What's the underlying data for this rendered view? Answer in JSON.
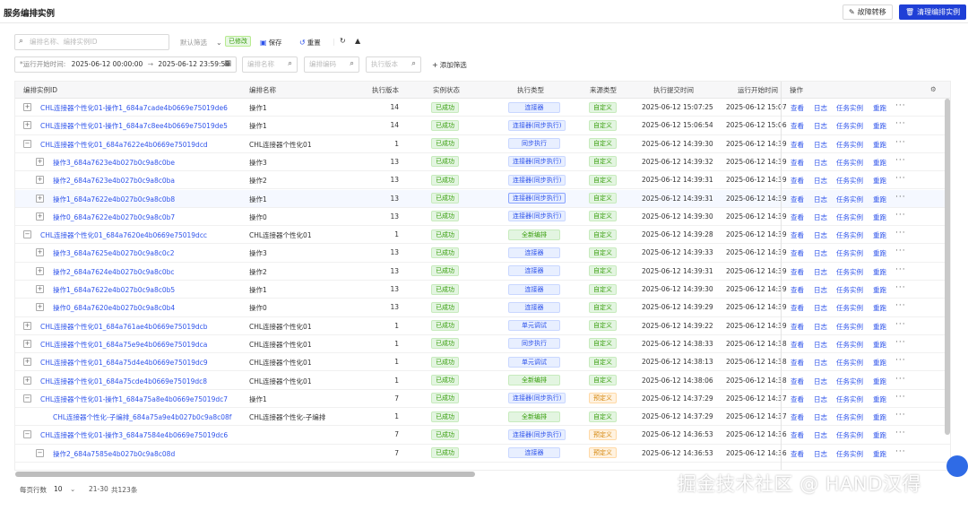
{
  "header": {
    "title": "服务编排实例",
    "failover_label": "故障转移",
    "clean_label": "清理编排实例"
  },
  "toolbar": {
    "search_placeholder": "编排名称、编排实例ID",
    "filter_label": "默认筛选",
    "modified_badge": "已修改",
    "save_label": "保存",
    "reset_label": "重置"
  },
  "filters": {
    "time_label": "*运行开始时间:",
    "time_start": "2025-06-12 00:00:00",
    "time_sep": "→",
    "time_end": "2025-06-12 23:59:59",
    "name_placeholder": "编排名称",
    "code_placeholder": "编排编码",
    "version_placeholder": "执行版本",
    "add_filter_label": "添加筛选"
  },
  "table": {
    "columns": [
      "编排实例ID",
      "编排名称",
      "执行版本",
      "实例状态",
      "执行类型",
      "来源类型",
      "执行提交时间",
      "运行开始时间",
      "操作"
    ],
    "actions": [
      "查看",
      "日志",
      "任务实例",
      "重跑"
    ],
    "rows": [
      {
        "indent": 0,
        "exp": "+",
        "id": "CHL连接器个性化01-操作1_684a7cade4b0669e75019de6",
        "name": "操作1",
        "ver": "14",
        "status": "已成功",
        "type": "连接器",
        "tstyle": "exec",
        "src": "自定义",
        "sstyle": "src",
        "submit": "2025-06-12 15:07:25",
        "start": "2025-06-12 15:07"
      },
      {
        "indent": 0,
        "exp": "+",
        "id": "CHL连接器个性化01-操作1_684a7c8ee4b0669e75019de5",
        "name": "操作1",
        "ver": "14",
        "status": "已成功",
        "type": "连接器(同步执行)",
        "tstyle": "exec",
        "src": "自定义",
        "sstyle": "src",
        "submit": "2025-06-12 15:06:54",
        "start": "2025-06-12 15:06"
      },
      {
        "indent": 0,
        "exp": "−",
        "id": "CHL连接器个性化01_684a7622e4b0669e75019dcd",
        "name": "CHL连接器个性化01",
        "ver": "1",
        "status": "已成功",
        "type": "同步执行",
        "tstyle": "exec",
        "src": "自定义",
        "sstyle": "src",
        "submit": "2025-06-12 14:39:30",
        "start": "2025-06-12 14:39"
      },
      {
        "indent": 1,
        "exp": "+",
        "id": "操作3_684a7623e4b027b0c9a8c0be",
        "name": "操作3",
        "ver": "13",
        "status": "已成功",
        "type": "连接器(同步执行)",
        "tstyle": "exec",
        "src": "自定义",
        "sstyle": "src",
        "submit": "2025-06-12 14:39:32",
        "start": "2025-06-12 14:39"
      },
      {
        "indent": 1,
        "exp": "+",
        "id": "操作2_684a7623e4b027b0c9a8c0ba",
        "name": "操作2",
        "ver": "13",
        "status": "已成功",
        "type": "连接器(同步执行)",
        "tstyle": "exec",
        "src": "自定义",
        "sstyle": "src",
        "submit": "2025-06-12 14:39:31",
        "start": "2025-06-12 14:39"
      },
      {
        "indent": 1,
        "exp": "+",
        "id": "操作1_684a7622e4b027b0c9a8c0b8",
        "name": "操作1",
        "ver": "13",
        "status": "已成功",
        "type": "连接器(同步执行)",
        "tstyle": "exec outline",
        "src": "自定义",
        "sstyle": "src",
        "submit": "2025-06-12 14:39:31",
        "start": "2025-06-12 14:39",
        "sel": true
      },
      {
        "indent": 1,
        "exp": "+",
        "id": "操作0_684a7622e4b027b0c9a8c0b7",
        "name": "操作0",
        "ver": "13",
        "status": "已成功",
        "type": "连接器(同步执行)",
        "tstyle": "exec",
        "src": "自定义",
        "sstyle": "src",
        "submit": "2025-06-12 14:39:30",
        "start": "2025-06-12 14:39"
      },
      {
        "indent": 0,
        "exp": "−",
        "id": "CHL连接器个性化01_684a7620e4b0669e75019dcc",
        "name": "CHL连接器个性化01",
        "ver": "1",
        "status": "已成功",
        "type": "全新编排",
        "tstyle": "exec green",
        "src": "自定义",
        "sstyle": "src",
        "submit": "2025-06-12 14:39:28",
        "start": "2025-06-12 14:39"
      },
      {
        "indent": 1,
        "exp": "+",
        "id": "操作3_684a7625e4b027b0c9a8c0c2",
        "name": "操作3",
        "ver": "13",
        "status": "已成功",
        "type": "连接器",
        "tstyle": "exec",
        "src": "自定义",
        "sstyle": "src",
        "submit": "2025-06-12 14:39:33",
        "start": "2025-06-12 14:39"
      },
      {
        "indent": 1,
        "exp": "+",
        "id": "操作2_684a7624e4b027b0c9a8c0bc",
        "name": "操作2",
        "ver": "13",
        "status": "已成功",
        "type": "连接器",
        "tstyle": "exec",
        "src": "自定义",
        "sstyle": "src",
        "submit": "2025-06-12 14:39:31",
        "start": "2025-06-12 14:39"
      },
      {
        "indent": 1,
        "exp": "+",
        "id": "操作1_684a7622e4b027b0c9a8c0b5",
        "name": "操作1",
        "ver": "13",
        "status": "已成功",
        "type": "连接器",
        "tstyle": "exec",
        "src": "自定义",
        "sstyle": "src",
        "submit": "2025-06-12 14:39:30",
        "start": "2025-06-12 14:39"
      },
      {
        "indent": 1,
        "exp": "+",
        "id": "操作0_684a7620e4b027b0c9a8c0b4",
        "name": "操作0",
        "ver": "13",
        "status": "已成功",
        "type": "连接器",
        "tstyle": "exec",
        "src": "自定义",
        "sstyle": "src",
        "submit": "2025-06-12 14:39:29",
        "start": "2025-06-12 14:39"
      },
      {
        "indent": 0,
        "exp": "+",
        "id": "CHL连接器个性化01_684a761ae4b0669e75019dcb",
        "name": "CHL连接器个性化01",
        "ver": "1",
        "status": "已成功",
        "type": "单元调试",
        "tstyle": "exec",
        "src": "自定义",
        "sstyle": "src",
        "submit": "2025-06-12 14:39:22",
        "start": "2025-06-12 14:39"
      },
      {
        "indent": 0,
        "exp": "+",
        "id": "CHL连接器个性化01_684a75e9e4b0669e75019dca",
        "name": "CHL连接器个性化01",
        "ver": "1",
        "status": "已成功",
        "type": "同步执行",
        "tstyle": "exec",
        "src": "自定义",
        "sstyle": "src",
        "submit": "2025-06-12 14:38:33",
        "start": "2025-06-12 14:38"
      },
      {
        "indent": 0,
        "exp": "+",
        "id": "CHL连接器个性化01_684a75d4e4b0669e75019dc9",
        "name": "CHL连接器个性化01",
        "ver": "1",
        "status": "已成功",
        "type": "单元调试",
        "tstyle": "exec",
        "src": "自定义",
        "sstyle": "src",
        "submit": "2025-06-12 14:38:13",
        "start": "2025-06-12 14:38"
      },
      {
        "indent": 0,
        "exp": "+",
        "id": "CHL连接器个性化01_684a75cde4b0669e75019dc8",
        "name": "CHL连接器个性化01",
        "ver": "1",
        "status": "已成功",
        "type": "全新编排",
        "tstyle": "exec green",
        "src": "自定义",
        "sstyle": "src",
        "submit": "2025-06-12 14:38:06",
        "start": "2025-06-12 14:38"
      },
      {
        "indent": 0,
        "exp": "−",
        "id": "CHL连接器个性化01-操作1_684a75a8e4b0669e75019dc7",
        "name": "操作1",
        "ver": "7",
        "status": "已成功",
        "type": "连接器(同步执行)",
        "tstyle": "exec",
        "src": "预定义",
        "sstyle": "src pre",
        "submit": "2025-06-12 14:37:29",
        "start": "2025-06-12 14:37"
      },
      {
        "indent": 1,
        "exp": "",
        "id": "CHL连接器个性化-子编排_684a75a9e4b027b0c9a8c08f",
        "name": "CHL连接器个性化-子编排",
        "ver": "1",
        "status": "已成功",
        "type": "全新编排",
        "tstyle": "exec green",
        "src": "自定义",
        "sstyle": "src",
        "submit": "2025-06-12 14:37:29",
        "start": "2025-06-12 14:37"
      },
      {
        "indent": 0,
        "exp": "−",
        "id": "CHL连接器个性化01-操作3_684a7584e4b0669e75019dc6",
        "name": "",
        "ver": "7",
        "status": "已成功",
        "type": "连接器(同步执行)",
        "tstyle": "exec",
        "src": "预定义",
        "sstyle": "src pre",
        "submit": "2025-06-12 14:36:53",
        "start": "2025-06-12 14:36"
      },
      {
        "indent": 1,
        "exp": "−",
        "id": "操作2_684a7585e4b027b0c9a8c08d",
        "name": "",
        "ver": "7",
        "status": "已成功",
        "type": "连接器",
        "tstyle": "exec",
        "src": "预定义",
        "sstyle": "src pre",
        "submit": "2025-06-12 14:36:53",
        "start": "2025-06-12 14:36"
      }
    ]
  },
  "footer": {
    "page_size_label": "每页行数",
    "page_size": "10",
    "range": "21-30",
    "total": "共123条"
  },
  "watermark": "掘金技术社区 @ HAND汉得",
  "icons": {
    "search": "search-icon",
    "save": "save-icon",
    "reset": "reset-icon",
    "refresh": "refresh-icon",
    "collapse": "caret-up-icon",
    "calendar": "calendar-icon",
    "add": "plus-icon",
    "settings": "settings-icon",
    "failover": "edit-icon",
    "clean": "trash-icon"
  },
  "colors": {
    "primary": "#1f3fd6",
    "link": "#2f54eb",
    "success": "#389e0d",
    "warning": "#d4860b"
  }
}
